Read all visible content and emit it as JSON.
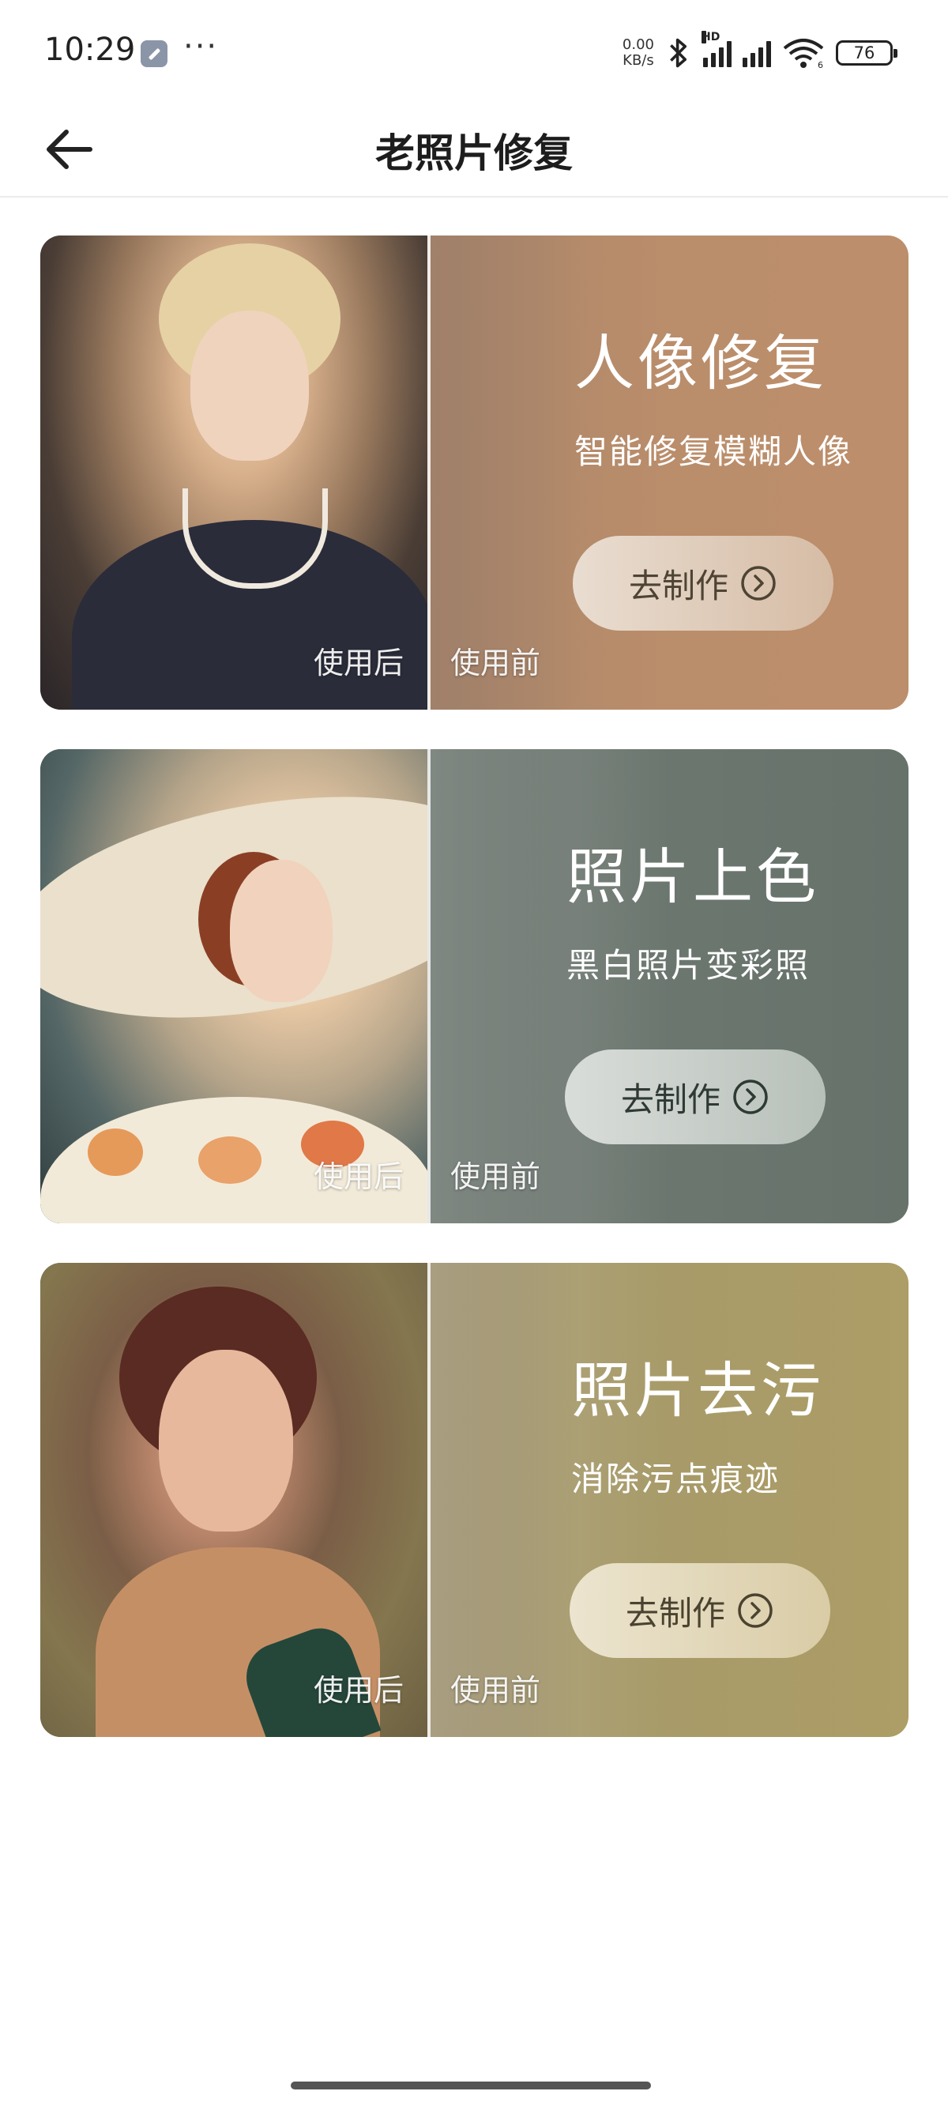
{
  "status_bar": {
    "time": "10:29",
    "more": "···",
    "net_speed_value": "0.00",
    "net_speed_unit": "KB/s",
    "signal_badge": "HD",
    "wifi_badge": "6",
    "battery": "76"
  },
  "header": {
    "title": "老照片修复",
    "back_icon": "arrow-left-icon"
  },
  "cards": [
    {
      "title": "人像修复",
      "subtitle": "智能修复模糊人像",
      "button_label": "去制作",
      "after_label": "使用后",
      "before_label": "使用前"
    },
    {
      "title": "照片上色",
      "subtitle": "黑白照片变彩照",
      "button_label": "去制作",
      "after_label": "使用后",
      "before_label": "使用前"
    },
    {
      "title": "照片去污",
      "subtitle": "消除污点痕迹",
      "button_label": "去制作",
      "after_label": "使用后",
      "before_label": "使用前"
    }
  ],
  "colors": {
    "card_1": "#b98d6b",
    "card_2": "#67726b",
    "card_3": "#ad9d66"
  }
}
